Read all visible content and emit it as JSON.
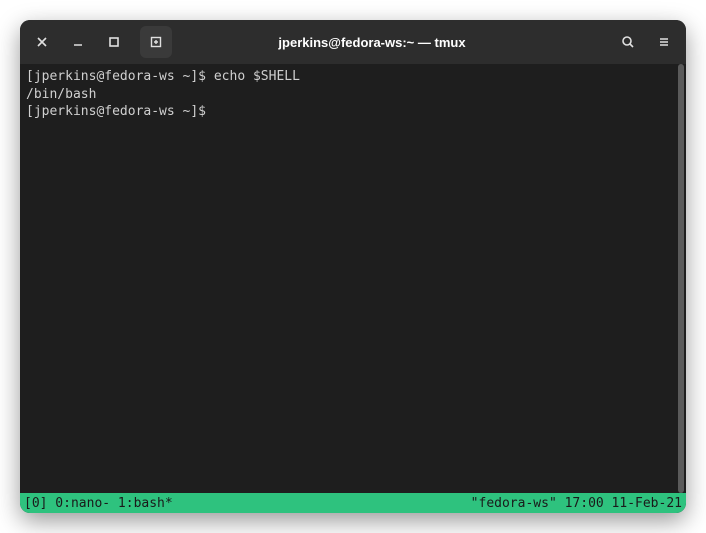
{
  "titlebar": {
    "title": "jperkins@fedora-ws:~ — tmux"
  },
  "terminal": {
    "lines": [
      "[jperkins@fedora-ws ~]$ echo $SHELL",
      "/bin/bash",
      "[jperkins@fedora-ws ~]$ "
    ]
  },
  "tmux": {
    "left": "[0] 0:nano- 1:bash*",
    "right": "\"fedora-ws\" 17:00 11-Feb-21"
  },
  "icons": {
    "close": "close-icon",
    "minimize": "minimize-icon",
    "maximize": "maximize-icon",
    "newtab": "newtab-icon",
    "search": "search-icon",
    "menu": "menu-icon"
  }
}
